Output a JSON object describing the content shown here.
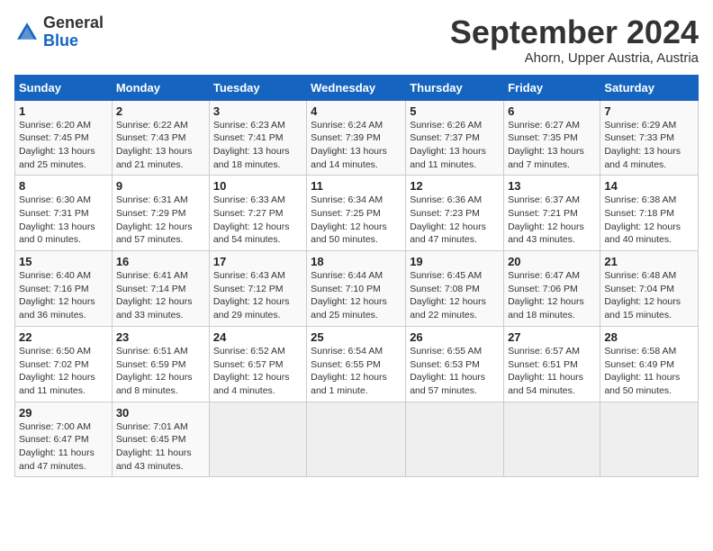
{
  "header": {
    "logo_general": "General",
    "logo_blue": "Blue",
    "month": "September 2024",
    "location": "Ahorn, Upper Austria, Austria"
  },
  "columns": [
    "Sunday",
    "Monday",
    "Tuesday",
    "Wednesday",
    "Thursday",
    "Friday",
    "Saturday"
  ],
  "weeks": [
    [
      {
        "day": "1",
        "info": "Sunrise: 6:20 AM\nSunset: 7:45 PM\nDaylight: 13 hours\nand 25 minutes."
      },
      {
        "day": "2",
        "info": "Sunrise: 6:22 AM\nSunset: 7:43 PM\nDaylight: 13 hours\nand 21 minutes."
      },
      {
        "day": "3",
        "info": "Sunrise: 6:23 AM\nSunset: 7:41 PM\nDaylight: 13 hours\nand 18 minutes."
      },
      {
        "day": "4",
        "info": "Sunrise: 6:24 AM\nSunset: 7:39 PM\nDaylight: 13 hours\nand 14 minutes."
      },
      {
        "day": "5",
        "info": "Sunrise: 6:26 AM\nSunset: 7:37 PM\nDaylight: 13 hours\nand 11 minutes."
      },
      {
        "day": "6",
        "info": "Sunrise: 6:27 AM\nSunset: 7:35 PM\nDaylight: 13 hours\nand 7 minutes."
      },
      {
        "day": "7",
        "info": "Sunrise: 6:29 AM\nSunset: 7:33 PM\nDaylight: 13 hours\nand 4 minutes."
      }
    ],
    [
      {
        "day": "8",
        "info": "Sunrise: 6:30 AM\nSunset: 7:31 PM\nDaylight: 13 hours\nand 0 minutes."
      },
      {
        "day": "9",
        "info": "Sunrise: 6:31 AM\nSunset: 7:29 PM\nDaylight: 12 hours\nand 57 minutes."
      },
      {
        "day": "10",
        "info": "Sunrise: 6:33 AM\nSunset: 7:27 PM\nDaylight: 12 hours\nand 54 minutes."
      },
      {
        "day": "11",
        "info": "Sunrise: 6:34 AM\nSunset: 7:25 PM\nDaylight: 12 hours\nand 50 minutes."
      },
      {
        "day": "12",
        "info": "Sunrise: 6:36 AM\nSunset: 7:23 PM\nDaylight: 12 hours\nand 47 minutes."
      },
      {
        "day": "13",
        "info": "Sunrise: 6:37 AM\nSunset: 7:21 PM\nDaylight: 12 hours\nand 43 minutes."
      },
      {
        "day": "14",
        "info": "Sunrise: 6:38 AM\nSunset: 7:18 PM\nDaylight: 12 hours\nand 40 minutes."
      }
    ],
    [
      {
        "day": "15",
        "info": "Sunrise: 6:40 AM\nSunset: 7:16 PM\nDaylight: 12 hours\nand 36 minutes."
      },
      {
        "day": "16",
        "info": "Sunrise: 6:41 AM\nSunset: 7:14 PM\nDaylight: 12 hours\nand 33 minutes."
      },
      {
        "day": "17",
        "info": "Sunrise: 6:43 AM\nSunset: 7:12 PM\nDaylight: 12 hours\nand 29 minutes."
      },
      {
        "day": "18",
        "info": "Sunrise: 6:44 AM\nSunset: 7:10 PM\nDaylight: 12 hours\nand 25 minutes."
      },
      {
        "day": "19",
        "info": "Sunrise: 6:45 AM\nSunset: 7:08 PM\nDaylight: 12 hours\nand 22 minutes."
      },
      {
        "day": "20",
        "info": "Sunrise: 6:47 AM\nSunset: 7:06 PM\nDaylight: 12 hours\nand 18 minutes."
      },
      {
        "day": "21",
        "info": "Sunrise: 6:48 AM\nSunset: 7:04 PM\nDaylight: 12 hours\nand 15 minutes."
      }
    ],
    [
      {
        "day": "22",
        "info": "Sunrise: 6:50 AM\nSunset: 7:02 PM\nDaylight: 12 hours\nand 11 minutes."
      },
      {
        "day": "23",
        "info": "Sunrise: 6:51 AM\nSunset: 6:59 PM\nDaylight: 12 hours\nand 8 minutes."
      },
      {
        "day": "24",
        "info": "Sunrise: 6:52 AM\nSunset: 6:57 PM\nDaylight: 12 hours\nand 4 minutes."
      },
      {
        "day": "25",
        "info": "Sunrise: 6:54 AM\nSunset: 6:55 PM\nDaylight: 12 hours\nand 1 minute."
      },
      {
        "day": "26",
        "info": "Sunrise: 6:55 AM\nSunset: 6:53 PM\nDaylight: 11 hours\nand 57 minutes."
      },
      {
        "day": "27",
        "info": "Sunrise: 6:57 AM\nSunset: 6:51 PM\nDaylight: 11 hours\nand 54 minutes."
      },
      {
        "day": "28",
        "info": "Sunrise: 6:58 AM\nSunset: 6:49 PM\nDaylight: 11 hours\nand 50 minutes."
      }
    ],
    [
      {
        "day": "29",
        "info": "Sunrise: 7:00 AM\nSunset: 6:47 PM\nDaylight: 11 hours\nand 47 minutes."
      },
      {
        "day": "30",
        "info": "Sunrise: 7:01 AM\nSunset: 6:45 PM\nDaylight: 11 hours\nand 43 minutes."
      },
      {
        "day": "",
        "info": ""
      },
      {
        "day": "",
        "info": ""
      },
      {
        "day": "",
        "info": ""
      },
      {
        "day": "",
        "info": ""
      },
      {
        "day": "",
        "info": ""
      }
    ]
  ]
}
